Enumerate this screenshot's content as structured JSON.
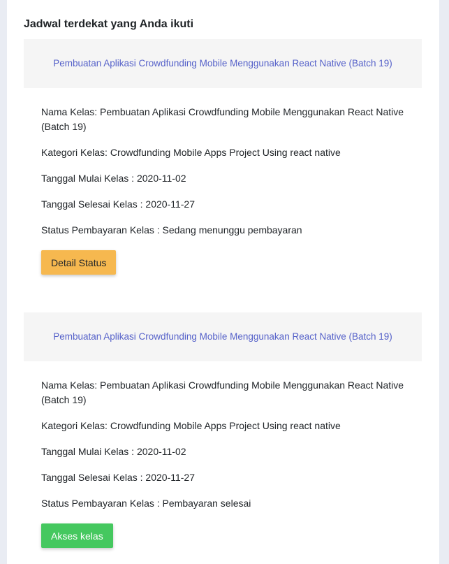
{
  "section": {
    "title": "Jadwal terdekat yang Anda ikuti"
  },
  "cards": [
    {
      "header_title": "Pembuatan Aplikasi Crowdfunding Mobile Menggunakan React Native (Batch 19)",
      "nama_kelas": "Nama Kelas: Pembuatan Aplikasi Crowdfunding Mobile Menggunakan React Native (Batch 19)",
      "kategori_kelas": "Kategori Kelas: Crowdfunding Mobile Apps Project Using react native",
      "tanggal_mulai": "Tanggal Mulai Kelas : 2020-11-02",
      "tanggal_selesai": "Tanggal Selesai Kelas : 2020-11-27",
      "status_pembayaran": "Status Pembayaran Kelas : Sedang menunggu pembayaran",
      "button_label": "Detail Status",
      "button_color": "#f6b84f"
    },
    {
      "header_title": "Pembuatan Aplikasi Crowdfunding Mobile Menggunakan React Native (Batch 19)",
      "nama_kelas": "Nama Kelas: Pembuatan Aplikasi Crowdfunding Mobile Menggunakan React Native (Batch 19)",
      "kategori_kelas": "Kategori Kelas: Crowdfunding Mobile Apps Project Using react native",
      "tanggal_mulai": "Tanggal Mulai Kelas : 2020-11-02",
      "tanggal_selesai": "Tanggal Selesai Kelas : 2020-11-27",
      "status_pembayaran": "Status Pembayaran Kelas : Pembayaran selesai",
      "button_label": "Akses kelas",
      "button_color": "#45c85f"
    }
  ],
  "colors": {
    "link": "#5561c9",
    "page_background": "#e9ecf3",
    "card_header_background": "#f5f5f5"
  }
}
